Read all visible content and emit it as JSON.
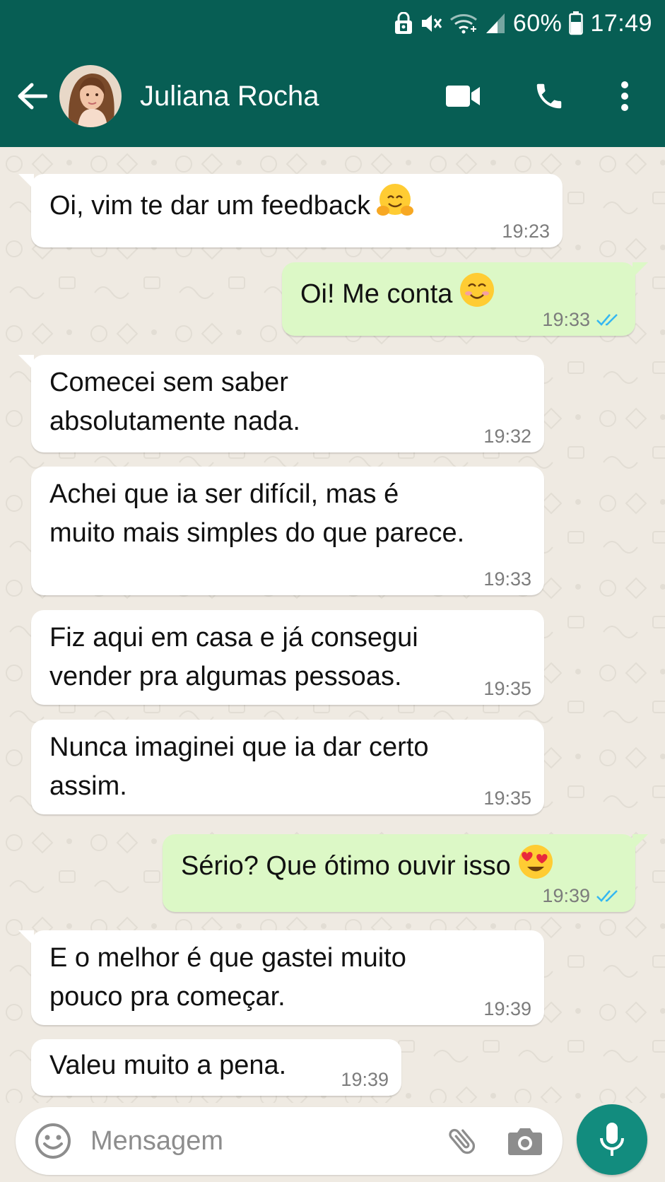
{
  "status_bar": {
    "battery": "60%",
    "time": "17:49",
    "icons": [
      "lock-icon",
      "mute-icon",
      "wifi-icon",
      "signal-icon",
      "battery-icon"
    ]
  },
  "header": {
    "contact_name": "Juliana Rocha",
    "icons": [
      "back-arrow-icon",
      "avatar",
      "video-call-icon",
      "phone-icon",
      "more-vert-icon"
    ],
    "color": "#075e54"
  },
  "messages": [
    {
      "direction": "in",
      "text": "Oi, vim te dar um feedback",
      "emoji": "hugging-face",
      "time": "19:23"
    },
    {
      "direction": "out",
      "text": "Oi! Me conta",
      "emoji": "smiling-face",
      "time": "19:33",
      "status": "read"
    },
    {
      "direction": "in",
      "lines": [
        "Comecei sem saber",
        "absolutamente nada."
      ],
      "time": "19:32"
    },
    {
      "direction": "in",
      "lines": [
        "Achei que ia ser difícil, mas é",
        "muito mais simples do que parece."
      ],
      "time": "19:33"
    },
    {
      "direction": "in",
      "lines": [
        "Fiz aqui em casa e já consegui",
        "vender pra algumas pessoas."
      ],
      "time": "19:35"
    },
    {
      "direction": "in",
      "lines": [
        "Nunca imaginei que ia dar certo",
        "assim."
      ],
      "time": "19:35"
    },
    {
      "direction": "out",
      "text": "Sério? Que ótimo ouvir isso",
      "emoji": "heart-eyes-face",
      "time": "19:39",
      "status": "read"
    },
    {
      "direction": "in",
      "lines": [
        "E o melhor é que gastei muito",
        "pouco pra começar."
      ],
      "time": "19:39"
    },
    {
      "direction": "in",
      "text": "Valeu muito a pena.",
      "time": "19:39"
    }
  ],
  "input": {
    "placeholder": "Mensagem",
    "value": "",
    "icons": [
      "emoji-icon",
      "attach-icon",
      "camera-icon",
      "mic-icon"
    ]
  },
  "colors": {
    "incoming_bubble": "#ffffff",
    "outgoing_bubble": "#dcf8c6",
    "read_ticks": "#34b7f1",
    "chat_background": "#efeae2",
    "mic_button": "#128c7e"
  }
}
